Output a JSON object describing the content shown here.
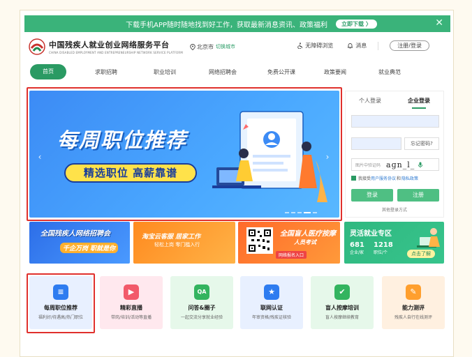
{
  "topbar": {
    "text": "下载手机APP随时随地找到好工作，获取最新消息资讯、政策福利",
    "download_label": "立即下载 〉",
    "close_glyph": "✕"
  },
  "header": {
    "brand_title": "中国残疾人就业创业网络服务平台",
    "brand_subtitle": "CHINA DISABLED EMPLOYMENT AND ENTREPRENEURSHIP NETWORK SERVICE PLATFORM",
    "location": "北京市",
    "switch_city": "切换城市",
    "accessibility": "无障碍浏览",
    "messages": "消息",
    "login_register": "注册/登录"
  },
  "nav": {
    "items": [
      "首页",
      "求职招聘",
      "职业培训",
      "网络招聘会",
      "免费公开课",
      "政策要闻",
      "就业典范"
    ]
  },
  "banner": {
    "title": "每周职位推荐",
    "subtitle": "精选职位 高薪靠谱",
    "prev": "‹",
    "next": "›"
  },
  "login": {
    "tab_personal": "个人登录",
    "tab_company": "企业登录",
    "forgot": "忘记密码?",
    "captcha_placeholder": "图片中验证码",
    "captcha_text": "aɡn_l_",
    "agree_prefix": "我接受",
    "agree_link1": "用户服务协议",
    "agree_and": "和",
    "agree_link2": "隐私政策",
    "login_button": "登录",
    "register_button": "注册",
    "other_methods": "其他登录方式"
  },
  "promos": {
    "p1_title": "全国残疾人网络招聘会",
    "p1_sub": "千企万岗 职就是你",
    "p2_title": "淘宝云客服 居家工作",
    "p2_sub": "轻松上岗 零门槛入行",
    "p3_title": "全国盲人医疗按摩",
    "p3_sub": "人员考试",
    "p3_sub2": "网络报名入口",
    "p4_title": "灵活就业专区",
    "p4_companies": "681",
    "p4_companies_label": "企业/家",
    "p4_jobs": "1218",
    "p4_jobs_label": "职位/个",
    "p4_cta": "点击了解"
  },
  "services": [
    {
      "name": "每周职位推荐",
      "desc": "福利好/待遇高/热门职位",
      "icon": "document-list-icon",
      "glyph": "≡"
    },
    {
      "name": "精彩直播",
      "desc": "带岗/培训/活动等直播",
      "icon": "play-icon",
      "glyph": "▶"
    },
    {
      "name": "问答&圈子",
      "desc": "一起交流分享就业经验",
      "icon": "qa-chat-icon",
      "glyph": "QA"
    },
    {
      "name": "联网认证",
      "desc": "年审资格/残疾证核验",
      "icon": "bookmark-star-icon",
      "glyph": "★"
    },
    {
      "name": "盲人按摩培训",
      "desc": "盲人按摩继续教育",
      "icon": "certificate-icon",
      "glyph": "✔"
    },
    {
      "name": "能力测评",
      "desc": "残疾人自行在线测评",
      "icon": "pencil-icon",
      "glyph": "✎"
    }
  ],
  "colors": {
    "brand_green": "#3ab37a",
    "highlight_red": "#e0302c",
    "banner_blue": "#3c8bf5"
  }
}
